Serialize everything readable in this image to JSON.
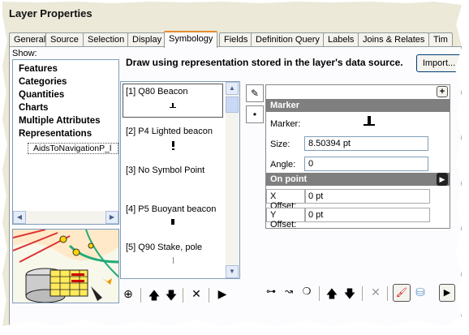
{
  "window": {
    "title": "Layer Properties"
  },
  "tabs": [
    {
      "label": "General"
    },
    {
      "label": "Source"
    },
    {
      "label": "Selection"
    },
    {
      "label": "Display"
    },
    {
      "label": "Symbology"
    },
    {
      "label": "Fields"
    },
    {
      "label": "Definition Query"
    },
    {
      "label": "Labels"
    },
    {
      "label": "Joins & Relates"
    },
    {
      "label": "Tim"
    }
  ],
  "active_tab": "Symbology",
  "show": {
    "label": "Show:",
    "categories": [
      "Features",
      "Categories",
      "Quantities",
      "Charts",
      "Multiple Attributes",
      "Representations"
    ],
    "selected_sub": "AidsToNavigationP_l"
  },
  "description": "Draw using representation stored in the layer's data source.",
  "import_button": "Import...",
  "representations": [
    {
      "label": "[1] Q80 Beacon"
    },
    {
      "label": "[2] P4 Lighted beacon"
    },
    {
      "label": "[3] No Symbol Point"
    },
    {
      "label": "[4] P5 Buoyant beacon"
    },
    {
      "label": "[5] Q90 Stake, pole"
    }
  ],
  "marker_panel": {
    "header": "Marker",
    "marker_label": "Marker:",
    "size_label": "Size:",
    "size_value": "8.50394 pt",
    "angle_label": "Angle:",
    "angle_value": "0",
    "on_point_header": "On point",
    "x_offset_label": "X Offset:",
    "x_offset_value": "0 pt",
    "y_offset_label": "Y Offset:",
    "y_offset_value": "0 pt",
    "add_symbol": "+"
  },
  "icons": {
    "add": "⊕",
    "up": "🡅",
    "down": "🡇",
    "delete": "✕",
    "more": "▶",
    "scroll_up": "▲",
    "scroll_down": "▼",
    "scroll_left": "◀",
    "scroll_right": "▶"
  }
}
